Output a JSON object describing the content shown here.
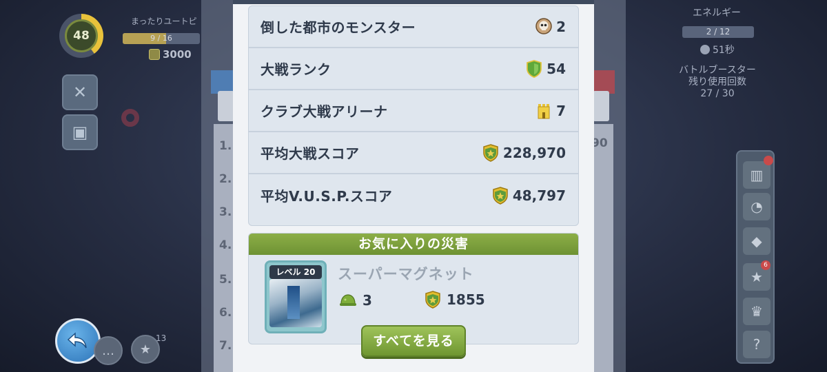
{
  "hud": {
    "level": "48",
    "player_name": "まったりユートピ",
    "xp": "9 / 16",
    "xp_fraction": 0.56,
    "coins": "3000",
    "energy_title": "エネルギー",
    "energy": "2 / 12",
    "energy_timer": "51秒",
    "booster_title": "バトルブースター",
    "booster_sub": "残り使用回数",
    "booster_count": "27 / 30",
    "messages_count": "13",
    "rail_badge": "6"
  },
  "background_list": {
    "ranks": [
      "1.",
      "2.",
      "3.",
      "4.",
      "5.",
      "6.",
      "7."
    ],
    "partial_score": "90"
  },
  "stats": [
    {
      "label": "倒した都市のモンスター",
      "value": "2",
      "icon": "skull-icon"
    },
    {
      "label": "大戦ランク",
      "value": "54",
      "icon": "green-shield-icon"
    },
    {
      "label": "クラブ大戦アリーナ",
      "value": "7",
      "icon": "tower-icon"
    },
    {
      "label": "平均大戦スコア",
      "value": "228,970",
      "icon": "gold-shield-icon"
    },
    {
      "label": "平均V.U.S.P.スコア",
      "value": "48,797",
      "icon": "gold-shield-icon"
    }
  ],
  "favorite": {
    "header": "お気に入りの災害",
    "level_label": "レベル 20",
    "name": "スーパーマグネット",
    "helmets": "3",
    "score": "1855"
  },
  "buttons": {
    "see_all": "すべてを見る"
  },
  "colors": {
    "accent_green": "#7ea23c",
    "back_blue": "#2d74b8"
  }
}
